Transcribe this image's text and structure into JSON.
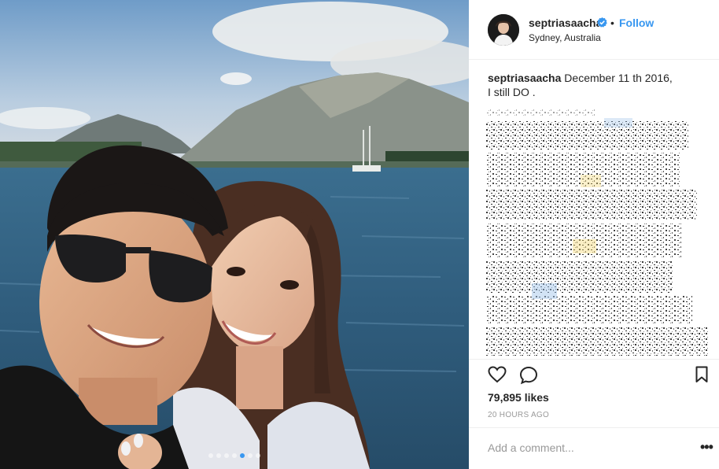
{
  "post": {
    "photo": {
      "alt_icon": "couple-selfie-lake-photo",
      "carousel": {
        "count": 7,
        "active_index": 4
      }
    },
    "header": {
      "username": "septriasaacha",
      "verified": true,
      "separator": "•",
      "follow_label": "Follow",
      "location": "Sydney, Australia"
    },
    "caption": {
      "author": "septriasaacha",
      "text_line1": " December 11 th 2016,",
      "text_line2": "I still DO ."
    },
    "actions": {
      "like_icon": "heart-outline-icon",
      "comment_icon": "speech-bubble-icon",
      "bookmark_icon": "bookmark-outline-icon"
    },
    "likes_text": "79,895 likes",
    "timestamp": "20 HOURS AGO",
    "comment_box": {
      "placeholder": "Add a comment...",
      "more_label": "•••"
    },
    "colors": {
      "accent": "#3897f0",
      "text": "#262626",
      "muted": "#999999",
      "divider": "#efefef"
    }
  }
}
